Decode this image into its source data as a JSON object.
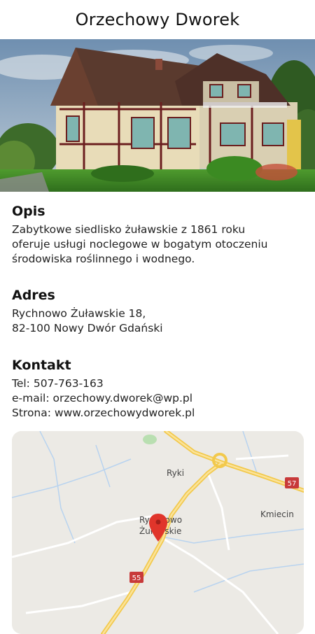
{
  "header": {
    "title": "Orzechowy Dworek"
  },
  "hero": {
    "image": "house-photo"
  },
  "sections": {
    "opis": {
      "heading": "Opis",
      "lines": [
        "Zabytkowe siedlisko żuławskie z 1861 roku",
        "oferuje usługi noclegowe w bogatym otoczeniu",
        "środowiska roślinnego i wodnego."
      ]
    },
    "adres": {
      "heading": "Adres",
      "lines": [
        "Rychnowo Żuławskie 18,",
        "82-100 Nowy Dwór Gdański"
      ]
    },
    "kontakt": {
      "heading": "Kontakt",
      "phone": "Tel: 507-763-163",
      "email": "e-mail: orzechowy.dworek@wp.pl",
      "website": "Strona: www.orzechowydworek.pl"
    }
  },
  "map": {
    "places": [
      "Ryki",
      "Rychnowo",
      "Żuławskie",
      "Kmiecin"
    ],
    "road_badges": [
      "57",
      "55"
    ],
    "colors": {
      "land": "#eceae5",
      "road_major": "#f9d25b",
      "road_minor": "#ffffff",
      "badge": "#c83a3a",
      "pin": "#e0352b"
    }
  }
}
